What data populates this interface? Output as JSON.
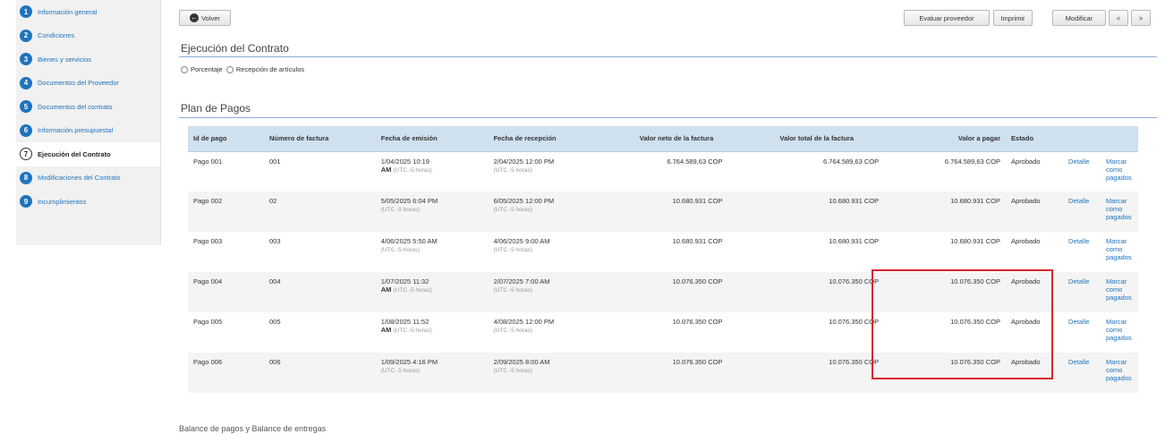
{
  "sidebar": {
    "items": [
      {
        "num": "1",
        "label": "Información general"
      },
      {
        "num": "2",
        "label": "Condiciones"
      },
      {
        "num": "3",
        "label": "Bienes y servicios"
      },
      {
        "num": "4",
        "label": "Documentos del Proveedor"
      },
      {
        "num": "5",
        "label": "Documentos del contrato"
      },
      {
        "num": "6",
        "label": "Información presupuestal"
      },
      {
        "num": "7",
        "label": "Ejecución del Contrato",
        "active": true
      },
      {
        "num": "8",
        "label": "Modificaciones del Contrato"
      },
      {
        "num": "9",
        "label": "Incumplimientos"
      }
    ]
  },
  "toolbar": {
    "back_label": "Volver",
    "evaluate_label": "Evaluar proveedor",
    "print_label": "Imprimir",
    "modify_label": "Modificar",
    "prev_label": "<",
    "next_label": ">"
  },
  "execution": {
    "title": "Ejecución del Contrato",
    "option_percentage": "Porcentaje",
    "option_reception": "Recepción de artículos"
  },
  "payments": {
    "title": "Plan de Pagos",
    "headers": {
      "id": "Id de pago",
      "invoice": "Número de factura",
      "issued": "Fecha de emisión",
      "received": "Fecha de recepción",
      "net": "Valor neto de la factura",
      "total": "Valor total de la factura",
      "pay": "Valor a pagar",
      "status": "Estado"
    },
    "tz_label": "(UTC -5 horas)",
    "detail_label": "Detalle",
    "mark_label": [
      "Marcar",
      "como",
      "pagados"
    ],
    "rows": [
      {
        "id": "Pago 001",
        "invoice": "001",
        "issued_a": "1/04/2025 10:19",
        "issued_b": "AM",
        "received": "2/04/2025 12:00 PM",
        "net": "6.764.589,63 COP",
        "total": "6.764.589,63 COP",
        "pay": "6.764.589,63 COP",
        "status": "Aprobado"
      },
      {
        "id": "Pago 002",
        "invoice": "02",
        "issued_a": "5/05/2025 6:04 PM",
        "issued_b": "",
        "received": "6/05/2025 12:00 PM",
        "net": "10.680.931 COP",
        "total": "10.680.931 COP",
        "pay": "10.680.931 COP",
        "status": "Aprobado"
      },
      {
        "id": "Pago 003",
        "invoice": "003",
        "issued_a": "4/06/2025 5:50 AM",
        "issued_b": "",
        "received": "4/06/2025 9:00 AM",
        "net": "10.680.931 COP",
        "total": "10.680.931 COP",
        "pay": "10.680.931 COP",
        "status": "Aprobado"
      },
      {
        "id": "Pago 004",
        "invoice": "004",
        "issued_a": "1/07/2025 11:32",
        "issued_b": "AM",
        "received": "2/07/2025 7:00 AM",
        "net": "10.076.350 COP",
        "total": "10.076.350 COP",
        "pay": "10.076.350 COP",
        "status": "Aprobado"
      },
      {
        "id": "Pago 005",
        "invoice": "005",
        "issued_a": "1/08/2025 11:52",
        "issued_b": "AM",
        "received": "4/08/2025 12:00 PM",
        "net": "10.076.350 COP",
        "total": "10.076.350 COP",
        "pay": "10.076.350 COP",
        "status": "Aprobado"
      },
      {
        "id": "Pago 006",
        "invoice": "006",
        "issued_a": "1/09/2025 4:16 PM",
        "issued_b": "",
        "received": "2/09/2025 8:00 AM",
        "net": "10.076.350 COP",
        "total": "10.076.350 COP",
        "pay": "10.076.350 COP",
        "status": "Aprobado"
      }
    ]
  },
  "balance": {
    "title": "Balance de pagos y Balance de entregas"
  },
  "colors": {
    "accent": "#1e73be",
    "header_bg": "#cfe0ef",
    "highlight": "#d9262b"
  }
}
